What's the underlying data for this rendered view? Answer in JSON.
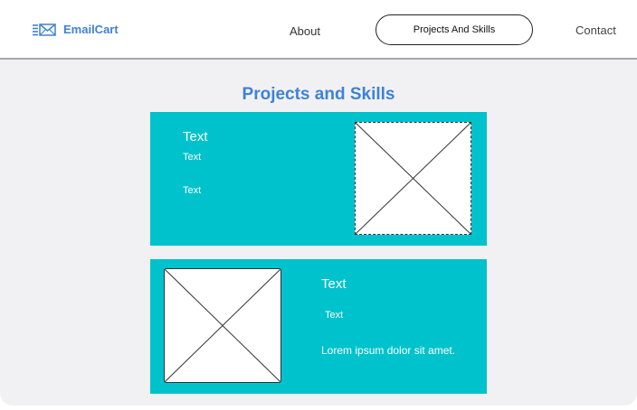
{
  "header": {
    "brand": "EmailCart",
    "nav": {
      "about": "About",
      "projects": "Projects And Skills",
      "contact": "Contact"
    }
  },
  "main": {
    "title": "Projects and Skills",
    "cards": [
      {
        "title": "Text",
        "line1": "Text",
        "line2": "Text"
      },
      {
        "title": "Text",
        "line1": "Text",
        "line2": "Lorem ipsum dolor sit amet."
      }
    ]
  },
  "colors": {
    "accent": "#3e82d4",
    "card_bg": "#00c2cc",
    "page_bg": "#f1f1f3"
  },
  "icons": {
    "logo": "email-icon",
    "placeholder": "image-placeholder-icon"
  }
}
